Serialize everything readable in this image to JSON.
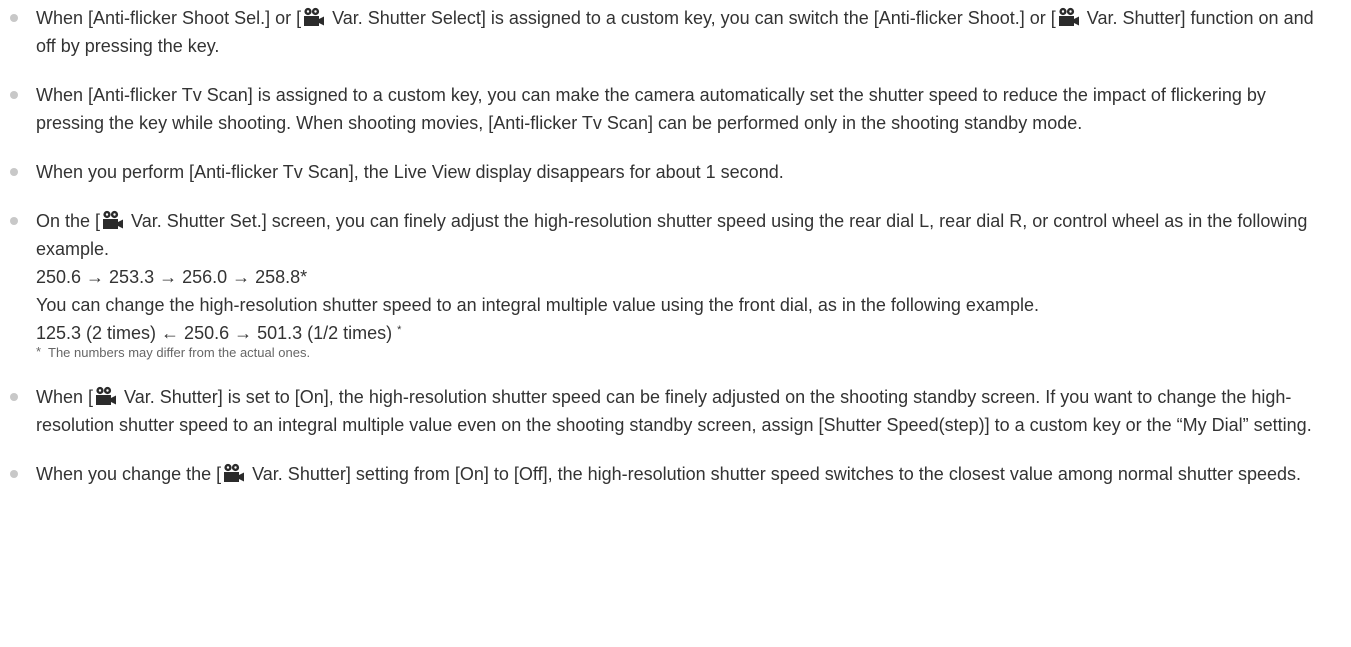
{
  "notes": [
    {
      "p1": "When [Anti-flicker Shoot Sel.] or [",
      "icon1": "movie-mode-icon",
      "p2": " Var. Shutter Select] is assigned to a custom key, you can switch the [Anti-flicker Shoot.] or [",
      "icon2": "movie-mode-icon",
      "p3": " Var. Shutter] function on and off by pressing the key."
    },
    {
      "text": "When [Anti-flicker Tv Scan] is assigned to a custom key, you can make the camera automatically set the shutter speed to reduce the impact of flickering by pressing the key while shooting. When shooting movies, [Anti-flicker Tv Scan] can be performed only in the shooting standby mode."
    },
    {
      "text": "When you perform [Anti-flicker Tv Scan], the Live View display disappears for about 1 second."
    },
    {
      "p1": "On the [",
      "icon1": "movie-mode-icon",
      "p2": " Var. Shutter Set.] screen, you can finely adjust the high-resolution shutter speed using the rear dial L, rear dial R, or control wheel as in the following example.",
      "example1": "250.6 → 253.3 → 256.0 → 258.8*",
      "p3": "You can change the high-resolution shutter speed to an integral multiple value using the front dial, as in the following example.",
      "example2": "125.3 (2 times) ← 250.6 → 501.3 (1/2 times) ",
      "example2_mark": "*",
      "footnote_mark": "*",
      "footnote": "The numbers may differ from the actual ones."
    },
    {
      "p1": "When [",
      "icon1": "movie-mode-icon",
      "p2": " Var. Shutter] is set to [On], the high-resolution shutter speed can be finely adjusted on the shooting standby screen. If you want to change the high-resolution shutter speed to an integral multiple value even on the shooting standby screen, assign [Shutter Speed(step)] to a custom key or the “My Dial” setting."
    },
    {
      "p1": "When you change the [",
      "icon1": "movie-mode-icon",
      "p2": " Var. Shutter] setting from [On] to [Off], the high-resolution shutter speed switches to the closest value among normal shutter speeds."
    }
  ]
}
